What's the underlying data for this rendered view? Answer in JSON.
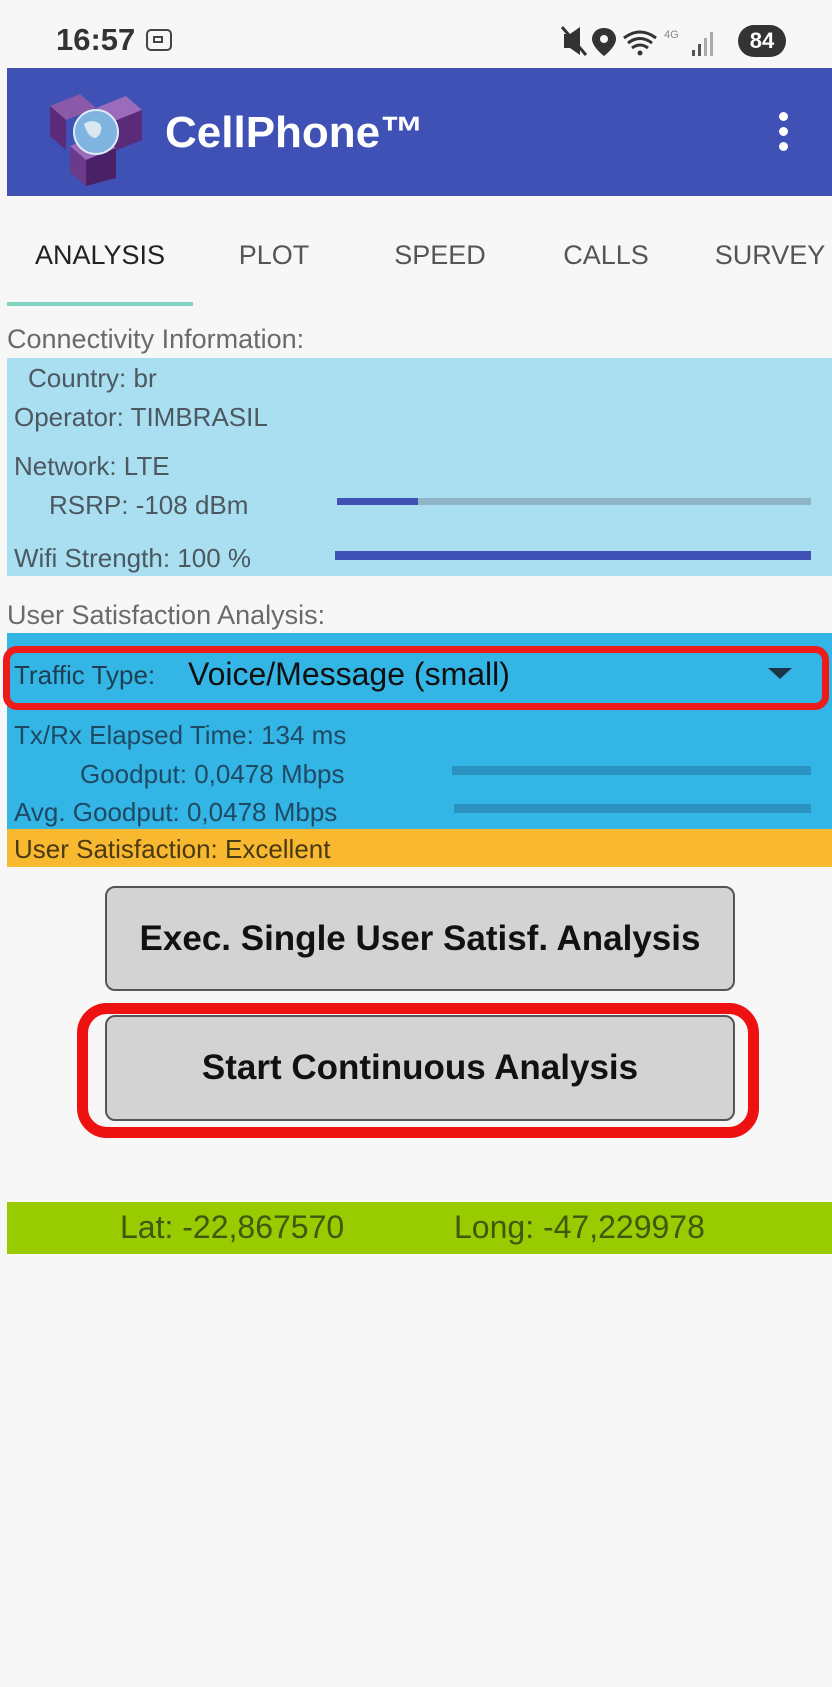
{
  "status_bar": {
    "time": "16:57",
    "network_type": "4G",
    "battery": "84",
    "icons": [
      "screenshot-icon",
      "mute-icon",
      "location-icon",
      "wifi-icon",
      "signal-icon",
      "battery-icon"
    ]
  },
  "app_bar": {
    "title": "CellPhone™",
    "logo": "cube-globe-logo",
    "menu_icon": "overflow-menu-icon",
    "color": "#3f51b5"
  },
  "tabs": [
    {
      "label": "ANALYSIS",
      "active": true
    },
    {
      "label": "PLOT",
      "active": false
    },
    {
      "label": "SPEED",
      "active": false
    },
    {
      "label": "CALLS",
      "active": false
    },
    {
      "label": "SURVEY",
      "active": false
    }
  ],
  "connectivity": {
    "title": "Connectivity Information:",
    "country": "Country: br",
    "operator": "Operator: TIMBRASIL",
    "network": "Network: LTE",
    "rsrp": "RSRP: -108 dBm",
    "rsrp_level": 0.17,
    "wifi": "Wifi Strength: 100 %",
    "wifi_level": 1.0
  },
  "user_satisfaction": {
    "title": "User Satisfaction Analysis:",
    "traffic_type_label": "Traffic Type:",
    "traffic_type_value": "Voice/Message (small)",
    "elapsed": "Tx/Rx Elapsed Time: 134 ms",
    "goodput": "Goodput: 0,0478 Mbps",
    "avg_goodput": "Avg. Goodput: 0,0478 Mbps",
    "satisfaction": "User Satisfaction: Excellent"
  },
  "buttons": {
    "single": "Exec. Single User Satisf. Analysis",
    "continuous": "Start Continuous Analysis"
  },
  "gps": {
    "lat": "Lat: -22,867570",
    "long": "Long: -47,229978"
  },
  "colors": {
    "accent_blue": "#3f51b5",
    "connectivity_bg": "#aadff1",
    "analysis_bg": "#33b5e5",
    "satisfaction_bg": "#f8b82f",
    "gps_bg": "#99cc00",
    "highlight_red": "#ee1111"
  }
}
